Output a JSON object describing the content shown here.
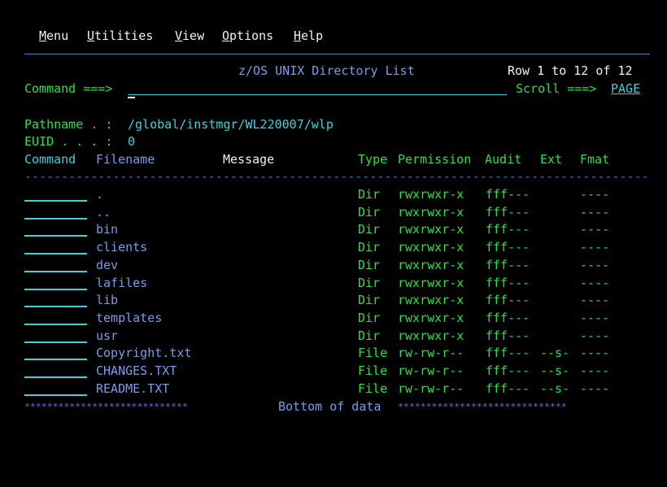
{
  "menu": {
    "items": [
      {
        "label": "Menu",
        "key": "M"
      },
      {
        "label": "Utilities",
        "key": "U"
      },
      {
        "label": "View",
        "key": "V"
      },
      {
        "label": "Options",
        "key": "O"
      },
      {
        "label": "Help",
        "key": "H"
      }
    ]
  },
  "header": {
    "title": "z/OS UNIX Directory List",
    "row_info": "Row 1 to 12 of 12",
    "command_label": "Command ===>",
    "command_value": "",
    "scroll_label": "Scroll ===>",
    "scroll_value": "PAGE"
  },
  "info": {
    "pathname_label": "Pathname . :",
    "pathname_value": "/global/instmgr/WL220007/wlp",
    "euid_label": "EUID . . . :",
    "euid_value": "0"
  },
  "columns": {
    "command": "Command",
    "filename": "Filename",
    "message": "Message",
    "type": "Type",
    "permission": "Permission",
    "audit": "Audit",
    "ext": "Ext",
    "fmat": "Fmat"
  },
  "separator": "-----------------------------------------------------------------------------------------------------",
  "rows": [
    {
      "filename": ".",
      "type": "Dir",
      "permission": "rwxrwxr-x",
      "audit": "fff---",
      "ext": "",
      "fmat": "----"
    },
    {
      "filename": "..",
      "type": "Dir",
      "permission": "rwxrwxr-x",
      "audit": "fff---",
      "ext": "",
      "fmat": "----"
    },
    {
      "filename": "bin",
      "type": "Dir",
      "permission": "rwxrwxr-x",
      "audit": "fff---",
      "ext": "",
      "fmat": "----"
    },
    {
      "filename": "clients",
      "type": "Dir",
      "permission": "rwxrwxr-x",
      "audit": "fff---",
      "ext": "",
      "fmat": "----"
    },
    {
      "filename": "dev",
      "type": "Dir",
      "permission": "rwxrwxr-x",
      "audit": "fff---",
      "ext": "",
      "fmat": "----"
    },
    {
      "filename": "lafiles",
      "type": "Dir",
      "permission": "rwxrwxr-x",
      "audit": "fff---",
      "ext": "",
      "fmat": "----"
    },
    {
      "filename": "lib",
      "type": "Dir",
      "permission": "rwxrwxr-x",
      "audit": "fff---",
      "ext": "",
      "fmat": "----"
    },
    {
      "filename": "templates",
      "type": "Dir",
      "permission": "rwxrwxr-x",
      "audit": "fff---",
      "ext": "",
      "fmat": "----"
    },
    {
      "filename": "usr",
      "type": "Dir",
      "permission": "rwxrwxr-x",
      "audit": "fff---",
      "ext": "",
      "fmat": "----"
    },
    {
      "filename": "Copyright.txt",
      "type": "File",
      "permission": "rw-rw-r--",
      "audit": "fff---",
      "ext": "--s-",
      "fmat": "----"
    },
    {
      "filename": "CHANGES.TXT",
      "type": "File",
      "permission": "rw-rw-r--",
      "audit": "fff---",
      "ext": "--s-",
      "fmat": "----"
    },
    {
      "filename": "README.TXT",
      "type": "File",
      "permission": "rw-rw-r--",
      "audit": "fff---",
      "ext": "--s-",
      "fmat": "----"
    }
  ],
  "footer": {
    "stars_left": "*****************************",
    "bottom_text": "Bottom of data",
    "stars_right": "******************************"
  },
  "colors": {
    "background": "#000000",
    "white": "#f2f2f2",
    "blue": "#7b9dea",
    "turquoise": "#3fd0d8",
    "green": "#33dd4a"
  }
}
